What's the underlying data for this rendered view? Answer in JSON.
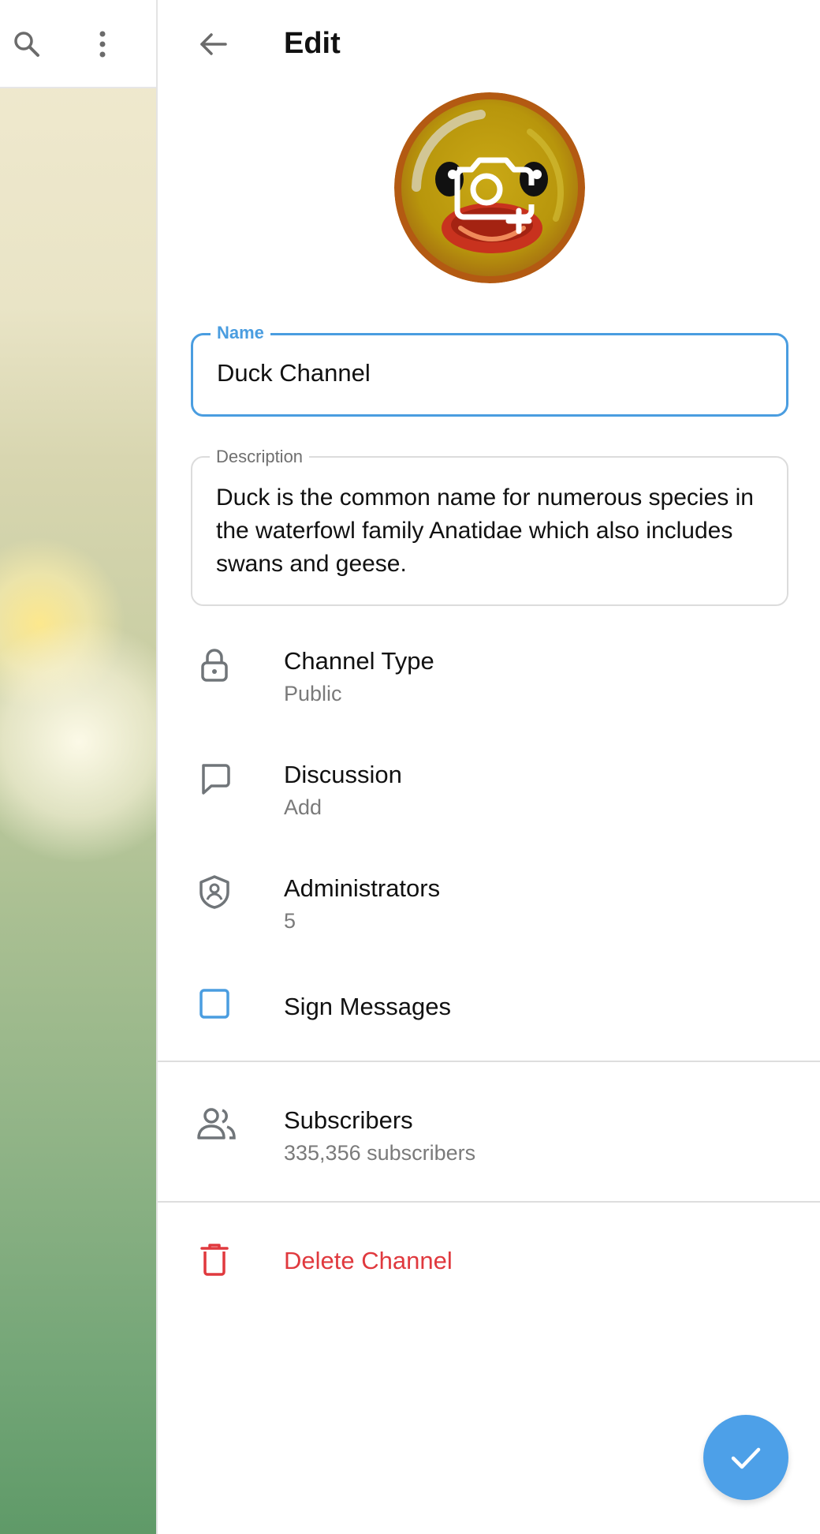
{
  "header": {
    "title": "Edit"
  },
  "name_field": {
    "legend": "Name",
    "value": "Duck Channel"
  },
  "description_field": {
    "legend": "Description",
    "value": "Duck is the common name for numerous species in the waterfowl family Anatidae which also includes swans and geese."
  },
  "rows": {
    "channel_type": {
      "label": "Channel Type",
      "sub": "Public",
      "icon": "lock-icon"
    },
    "discussion": {
      "label": "Discussion",
      "sub": "Add",
      "icon": "chat-bubble-icon"
    },
    "administrators": {
      "label": "Administrators",
      "sub": "5",
      "icon": "shield-user-icon"
    },
    "sign_messages": {
      "label": "Sign Messages",
      "checked": false,
      "icon": "checkbox-icon"
    },
    "subscribers": {
      "label": "Subscribers",
      "sub": "335,356 subscribers",
      "icon": "people-icon"
    },
    "delete": {
      "label": "Delete Channel",
      "icon": "trash-icon"
    }
  },
  "colors": {
    "accent": "#4a9de0",
    "danger": "#e0393e",
    "fab": "#4da0e8"
  }
}
